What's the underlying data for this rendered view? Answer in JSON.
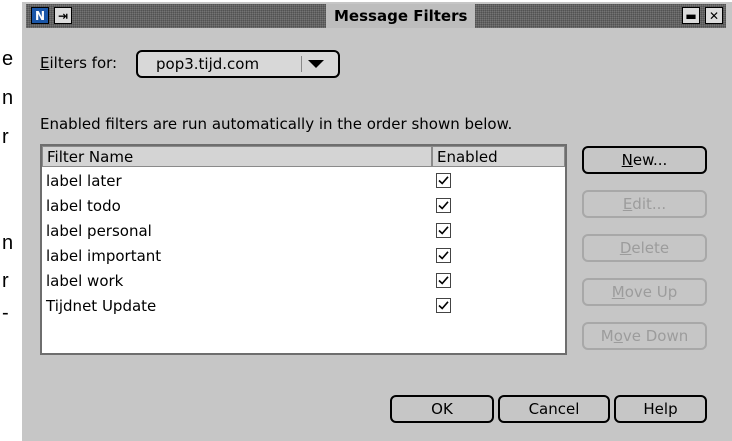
{
  "background_text": {
    "letters": [
      "e",
      "n",
      "r",
      "n",
      "r",
      "-"
    ]
  },
  "window": {
    "title": "Message Filters",
    "app_icon": "N",
    "menu_icon": "⇥",
    "minimize_icon": "▬",
    "close_icon": "✕"
  },
  "filters_for": {
    "label": "Filters for:",
    "label_mnemonic": "E",
    "label_rest": "ilters for:",
    "selected": "pop3.tijd.com"
  },
  "info_text": "Enabled filters are run automatically in the order shown below.",
  "table": {
    "columns": [
      "Filter Name",
      "Enabled"
    ],
    "rows": [
      {
        "name": "label later",
        "enabled": true
      },
      {
        "name": "label todo",
        "enabled": true
      },
      {
        "name": "label personal",
        "enabled": true
      },
      {
        "name": "label important",
        "enabled": true
      },
      {
        "name": "label work",
        "enabled": true
      },
      {
        "name": "Tijdnet Update",
        "enabled": true
      }
    ]
  },
  "side_buttons": {
    "new": {
      "mnemonic": "N",
      "rest": "ew...",
      "enabled": true
    },
    "edit": {
      "mnemonic": "E",
      "rest": "dit...",
      "enabled": false
    },
    "delete": {
      "mnemonic": "D",
      "rest": "elete",
      "enabled": false
    },
    "move_up": {
      "mnemonic": "M",
      "rest": "ove Up",
      "enabled": false
    },
    "move_down": {
      "prefix": "M",
      "mnemonic": "o",
      "rest": "ve Down",
      "enabled": false
    }
  },
  "bottom_buttons": {
    "ok": "OK",
    "cancel": "Cancel",
    "help": "Help"
  }
}
